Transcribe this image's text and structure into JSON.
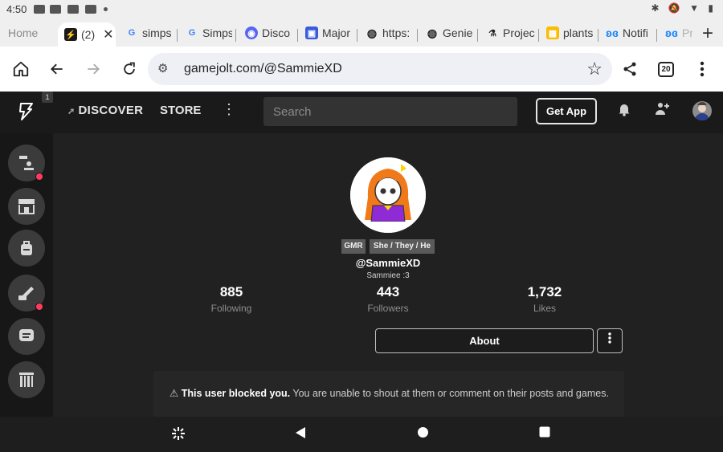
{
  "status": {
    "time": "4:50"
  },
  "tabs": [
    {
      "label": "Home",
      "icon": "home"
    },
    {
      "label": "(2)",
      "icon": "gamejolt",
      "active": true
    },
    {
      "label": "simps",
      "icon": "google"
    },
    {
      "label": "Simps",
      "icon": "google"
    },
    {
      "label": "Disco",
      "icon": "discord"
    },
    {
      "label": "Major",
      "icon": "bookmark"
    },
    {
      "label": "https:",
      "icon": "globe"
    },
    {
      "label": "Genie",
      "icon": "globe"
    },
    {
      "label": "Projec",
      "icon": "flask"
    },
    {
      "label": "plants",
      "icon": "bag"
    },
    {
      "label": "Notifi",
      "icon": "butterfly"
    },
    {
      "label": "Pr",
      "icon": "butterfly"
    }
  ],
  "browser": {
    "url": "gamejolt.com/@SammieXD",
    "tab_count": "20"
  },
  "site": {
    "nav_badge": "1",
    "discover": "DISCOVER",
    "store": "STORE",
    "search_placeholder": "Search",
    "get_app": "Get App"
  },
  "profile": {
    "tags": [
      "GMR",
      "She / They / He"
    ],
    "username": "@SammieXD",
    "display_name": "Sammiee :3",
    "stats": [
      {
        "value": "885",
        "label": "Following"
      },
      {
        "value": "443",
        "label": "Followers"
      },
      {
        "value": "1,732",
        "label": "Likes"
      }
    ],
    "about_label": "About",
    "blocked_bold": "This user blocked you.",
    "blocked_text": " You are unable to shout at them or comment on their posts and games."
  },
  "colors": {
    "accent_notify": "#ff3b5c",
    "header_bg": "#1a1a1a",
    "page_bg": "#212121"
  }
}
